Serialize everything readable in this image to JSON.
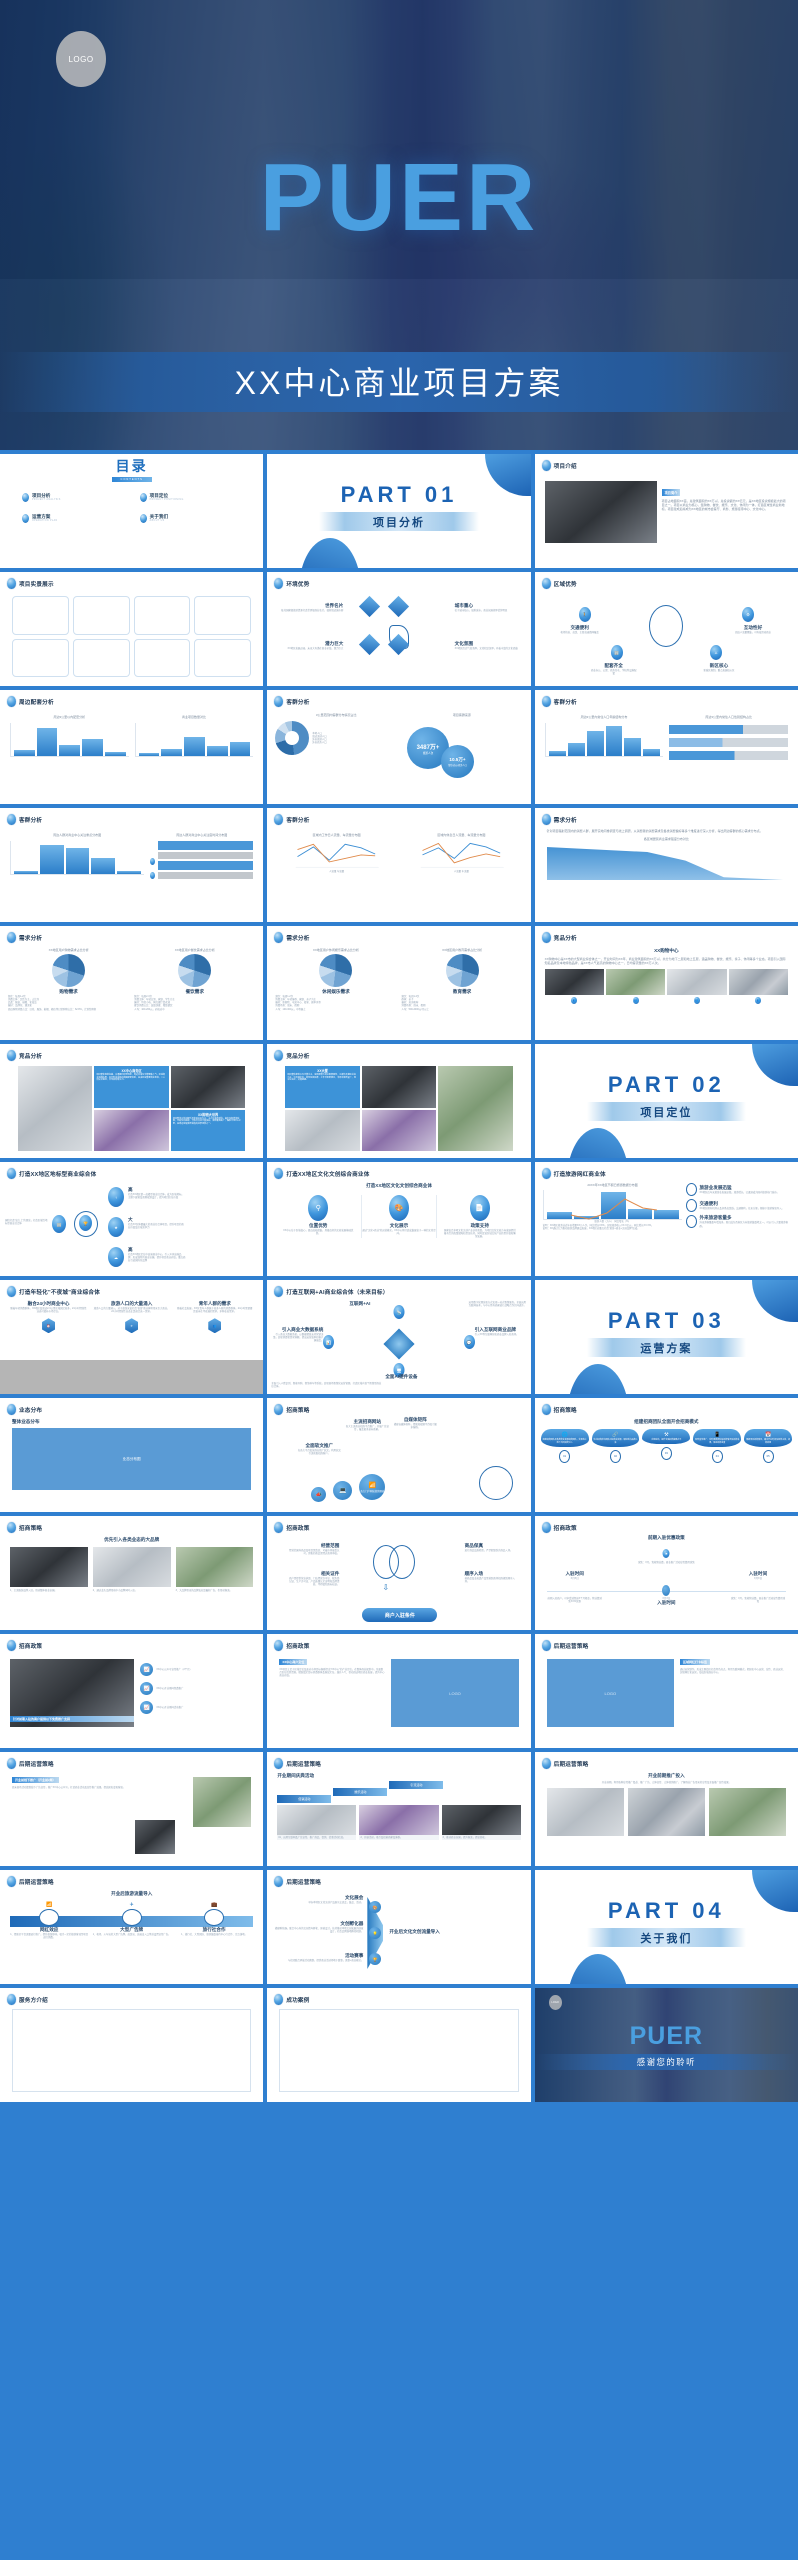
{
  "cover": {
    "logo": "LOGO",
    "title": "PUER",
    "subtitle": "XX中心商业项目方案"
  },
  "toc": {
    "heading": "目录",
    "heading_en": "CONTENTS",
    "items": [
      {
        "label": "项目分析",
        "sub": "PROJECT ANALYSIS"
      },
      {
        "label": "项目定位",
        "sub": "PROJECT POSITIONING"
      },
      {
        "label": "运营方案",
        "sub": "OPERATION PLAN"
      },
      {
        "label": "关于我们",
        "sub": "ABOUT US"
      }
    ]
  },
  "parts": [
    {
      "no": "PART  01",
      "name": "项目分析"
    },
    {
      "no": "PART  02",
      "name": "项目定位"
    },
    {
      "no": "PART  03",
      "name": "运营方案"
    },
    {
      "no": "PART  04",
      "name": "关于我们"
    }
  ],
  "thanks": {
    "logo": "LOGO",
    "title": "PUER",
    "subtitle": "感谢您的聆听"
  },
  "slides": {
    "s03": {
      "title": "项目介绍",
      "ribbon": "项目简介",
      "body": "项目占地面积XX亩，总建筑面积约XX万㎡，总投资额约XX亿元，是XX地区投资规模最大的项目之一。项目以商业为核心，集购物、餐饮、娱乐、文化、休闲为一体，打造区域性商业新地标。项目建成后将成为XX地区的城市会客厅、商务、旅游接待中心、文化中心。"
    },
    "s04": {
      "title": "项目实景展示"
    },
    "s05": {
      "title": "环境优势",
      "nodes": [
        {
          "label": "世界名片",
          "desc": "依托国家级旅游资源打造世界级商业名片，辐射周边城市群"
        },
        {
          "label": "城市重心",
          "desc": "位于城市核心，辐射城市，商业氛围浓厚优势明显"
        },
        {
          "label": "潜力巨大",
          "desc": "XX地区发展迅速，未来大有潜在商业价值，潜力巨大"
        },
        {
          "label": "文化氛围",
          "desc": "XX地区历史气息浓厚，文化积淀深厚，有着丰富的文化底蕴"
        }
      ]
    },
    "s06": {
      "title": "区域优势",
      "nodes": [
        {
          "label": "交通便利",
          "desc": "机场快轨、高铁、主要高速路网覆盖"
        },
        {
          "label": "互动性好",
          "desc": "周边人流量聚集，可有效带动商业"
        },
        {
          "label": "配套齐全",
          "desc": "商业办公、公寓、商务住宅、学校等设施配套"
        },
        {
          "label": "新区核心",
          "desc": "新城区规划，重点发展核心区"
        }
      ]
    },
    "s07": {
      "title": "周边配套分析",
      "chart_left_title": "周边3公里以内配套分析",
      "chart_right_title": "商业项目数量对比"
    },
    "s08": {
      "title": "客群分析",
      "donut_title": "3公里范围内客群分布情况占比",
      "legend": [
        "本地人口",
        "周边流动人口",
        "外来旅游人口",
        "外来商务人口"
      ],
      "bubble_title": "项目客群来源",
      "big_value": "3487万+",
      "big_label": "旅游人次",
      "small_value": "10.5万+",
      "small_label": "常住/办公/商务人口"
    },
    "s09": {
      "title": "客群分析",
      "chart_left_title": "周边3公里内常住人口年龄结构分布",
      "chart_right_title": "周边3公里内常住人口性别结构占比"
    },
    "s10": {
      "title": "客群分析",
      "chart_left_title": "周边人群对商业中心关注重点分布图",
      "chart_right_title": "周边人群对商业中心关注度时间分布图"
    },
    "s11": {
      "title": "客群分析",
      "chart_left_title": "区域内工作日人流量、车流量分布图",
      "chart_right_title": "区域内休息日人流量、车流量分布图",
      "legend": [
        "人流量",
        "车流量"
      ]
    },
    "s12": {
      "title": "需求分析",
      "intro": "针对项目辐射范围内的消费人群，展开实地问卷调查与线上调研，从消费者的消费需求及各类消费偏好等多个维度进行深入分析，得出周边客群的核心需求分布点。",
      "chart_title": "各区域居民商业需求强度分布对比"
    },
    "s13": {
      "title": "需求分析",
      "charts": [
        {
          "title": "XX地区用户购物需求占比分析",
          "label": "购物需求",
          "desc": "频次：每周1-2次\n消费主体：女性为主，占比约\n品类：服装、鞋帽、化妆品\n偏好：品牌化、潮流化\n周边购物消费占比：日化、服饰、鞋帽、箱包等日常购物占比：62.8%，计划性购物"
        },
        {
          "title": "XX地区用户餐饮需求占比分析",
          "label": "餐饮需求",
          "desc": "频次：每周2-3次\n消费主体：年轻白领、家庭、学生为主\n偏好：特色小吃、网红餐厅受欢迎\n餐饮消费占比：连锁快餐、精致餐饮\n人均：100-200元，价格适中"
        }
      ]
    },
    "s14": {
      "title": "需求分析",
      "charts": [
        {
          "title": "XX地区用户休闲娱乐需求占比分析",
          "label": "休闲娱乐需求",
          "desc": "频次：每周1-2次\n消费主体：年轻客群、家庭、亲子为主\n偏好：影剧院、电竞中心、密室、剧本杀等\n消费场景：周末、假期\n人均：100-300元，中等偏上"
        },
        {
          "title": "XX地区用户教育需求占比分析",
          "label": "教育需求",
          "desc": "频次：每周1-2次\n群体：亲子\n偏好：培训机构\n消费场景：周末、假期\n人均：500-2000元/月以上"
        }
      ]
    },
    "s15": {
      "title": "竞品分析",
      "sub": "XX购物中心",
      "body": "XX购物中心是XX市的大型商业综合体之一，开业时间为XX年，商业建筑面积约XX万㎡，共分为地下二层和地上五层，涵盖购物、餐饮、娱乐、亲子、休闲等多个业态。项目引入国际知名品牌及本地特色品牌，是XX市人气最高的购物中心之一，日均客流量约XX万人次。"
    },
    "s16": {
      "title": "竞品分析",
      "ribbon": "XX中心商务区",
      "ribbon2": "XX购物大世界",
      "body": "项目整体规划完善，交通便利优势明显，周边高端写字楼聚集人气，区域商业氛围浓厚，且已形成成熟的商圈配套体系，是该区域重要商业载体，二三层设计独特，非常具有吸引力。",
      "body2": "项目整体以休闲娱乐及体验业态为主，主力店涵盖影院、超市及各类体验馆，中庭空间宽敞，节假日活动丰富多彩，客群覆盖面广，辐射半径约5公里，是周边家庭客群首选的消费场所之一。"
    },
    "s17": {
      "title": "竞品分析",
      "ribbon": "XX大厦",
      "body": "项目整体建筑以写字楼为主，底部裙楼为商业配套服务，以餐饮及便民业态为主，中高端定位，商务氛围浓厚，工作日客群稳定，非周末客群量少，停车位充足，交通便捷。"
    },
    "s18": {
      "title": "打造XX地区地标型商业综合体",
      "center": "地标",
      "left_desc": "围绕打造\"高大上\"的理念，打造区域性地标型商业综合体",
      "nodes": [
        {
          "label": "高",
          "desc": "打造XX地区第一高楼型商业综合体，成为区域地标，主题下建筑及景观规划设计，提升项目区位价值"
        },
        {
          "label": "大",
          "desc": "打造XX区体量最大的商业综合体项目，提升项目的商业价值及区域竞争力"
        },
        {
          "label": "高",
          "desc": "打造XX地区定位中高端商业中心，引入众多高端品牌，形成独特的商业氛围，提升项目商业价值，重点商业引进国际化品牌"
        }
      ]
    },
    "s19": {
      "title": "打造XX地区文化文创综合商业体",
      "sub": "打造XX地区文化文创综合商业体",
      "cards": [
        {
          "label": "位置优势",
          "desc": "XX中心位于区域核心，周边高校密集，具备良好的文创发展基础优势。"
        },
        {
          "label": "文化展示",
          "desc": "通过\"文化+商业\"的运营模式，XX中心将打造成集展览于一体的文化空间。"
        },
        {
          "label": "政策支持",
          "desc": "国家出台多项文化文创产业扶持政策，为项目文化文创方向发展提供强有力的政策保障和资金扶持，同时促进区域文化产业转型升级和繁荣发展。"
        }
      ]
    },
    "s20": {
      "title": "打造旅游网红商业体",
      "chart_title": "20XX年XX地区节假日旅游数据分布图",
      "legend": [
        "旅游人数（万人）",
        "同比增长（%）"
      ],
      "nodes": [
        {
          "label": "旅游业发展迅猛",
          "desc": "XX地区近年来旅游业发展迅猛，旅游增长，已逐渐成为国内旅游热门城市。"
        },
        {
          "label": "交通便利",
          "desc": "XX地区拥有机场以及多条高铁线，交通便利，往来方便，便捷于旅游客流导入。"
        },
        {
          "label": "外来旅游客量多",
          "desc": "外来游客量逐年增加多，现已成为西南区方向旅游集散地之一，可以引入大量旅游客群。"
        }
      ],
      "footer": "说明：XX地区旅游业近年来增量XX万人次，同比增长XX%，实现旅游收入XX.X亿元，同比增长XX.X%。\n说明：XX通过大力推动旅游品牌建设发展，XX地区应重点打造\"旅游+商业+文创品牌\"形成。"
    },
    "s21": {
      "title": "打造年轻化\"不夜城\"商业综合体",
      "cards": [
        {
          "label": "融合24小时商业中心",
          "desc": "随着年轻消费群体，XX地区及周边2-3公里区域居民较多，24小时经营性业态可填补市场空白。"
        },
        {
          "label": "旅游人口的大量涌入",
          "desc": "旅游人口的大量涌入，对于旅游来说打造\"夜游\"商业体将带来巨大商业，24小时经营性业态正是迎合这一需求。"
        },
        {
          "label": "青年人群的需求",
          "desc": "随着社会发展，XX区青年人群属于较多人群的消费群体，24小时需要餐饮夜宵在不夜城的需求，多种业态需求。"
        }
      ]
    },
    "s22": {
      "title": "打造互联网+AI商业综合体（未来目标）",
      "nodes": [
        {
          "label": "互联网+AI",
          "desc": "运用数字化理念和方式实现一站式智慧服务，全面运用互联网技术，与中心所有商家进行战略合作共同进步。"
        },
        {
          "label": "引入商业大数据系统",
          "desc": "引入商业大数据系统，以数据精准支持营销决策，实现消费者需求洞察，提高运营效率和客户满意度。"
        },
        {
          "label": "引入互联网商业品牌",
          "desc": "引入XX等互联网知名商业品牌入驻商场。"
        },
        {
          "label": "全面AI硬件设备",
          "desc": "全面引入人脸识别、智能导购、智慧停车等系统，实现商场智慧化运营管理，打造区域内首个智慧型商业综合体。"
        }
      ]
    },
    "s23": {
      "title": "业态分布",
      "sub": "整体业态分布",
      "placeholder": "业态分布图"
    },
    "s24": {
      "title": "招商策略",
      "nodes": [
        {
          "label": "全面软文推广",
          "desc": "在各大平台投放商业推广软文，利用软文引流获取招商客户。"
        },
        {
          "label": "主流招商网站",
          "desc": "各大主流商业招商平台推广，开展广告宣传，覆盖更多意向商家。"
        },
        {
          "label": "自媒体矩阵",
          "desc": "搭建自媒体矩阵，借助短视频平台吸引更多客群。"
        },
        {
          "label": "各大门户网站营销预热",
          "desc": "在各大门户网站发布招商信息，提前进行品牌造势。"
        }
      ]
    },
    "s25": {
      "title": "招商策略",
      "sub": "组建招商团队全面开会招商模式",
      "steps": [
        {
          "no": "01",
          "desc": "组建招商团队及各类商业资源招商团队，实现线上线下共同招商引入"
        },
        {
          "no": "02",
          "desc": "外出招商拜访团队对应商业资源，取得重点品牌入驻"
        },
        {
          "no": "03",
          "desc": "定期总结，提升全面招商策略水平"
        },
        {
          "no": "04",
          "desc": "配合宣传推广、实时更新各阶段招商情况及招商成果，保证招商进度"
        },
        {
          "no": "05",
          "desc": "根据项目招商情况，确定开业时间及经营主体，招商收尾"
        }
      ]
    },
    "s26": {
      "title": "招商策略",
      "sub": "优先引入各类业态的大品牌",
      "captions": [
        "1、主流服饰品牌入驻，带动整体商业氛围。",
        "2、通过龙头品牌带动中小品牌同时入驻。",
        "3、大品牌带来的品牌效应是最好广告，也带动客流。"
      ]
    },
    "s27": {
      "title": "招商政策",
      "button": "商户入驻条件",
      "items": [
        {
          "label": "经营范围",
          "desc": "经营范围内商品及项目需真实、可被市场接受认可，销售的商品需经过商场审核。"
        },
        {
          "label": "商品保真",
          "desc": "进行商品品质检验，严禁假冒伪劣商品入场。"
        },
        {
          "label": "相关证件",
          "desc": "商户需提供营业执照、门店经营许可证、税务登记证、生产许可证、产品质量认定证明和品牌资质、不得侵犯商标权益。"
        },
        {
          "label": "顺序入场",
          "desc": "按商品及业态类产品需按照商场招商规划顺序入场。"
        }
      ]
    },
    "s28": {
      "title": "招商政策",
      "sub": "前期入驻优惠政策",
      "nodes": [
        {
          "label": "入驻时间",
          "date": "X月X日",
          "desc": "前期入驻商户，可享受减免前X个月租金，物业费减免XX%优惠"
        },
        {
          "label": "入驻时间",
          "date": "X月X日",
          "desc": "减免：X月，免收物业费，商业推广活动宣传费用减免"
        },
        {
          "label": "入驻时间",
          "date": "X月X日",
          "desc": "减免：X月，免收物业费，商业推广活动宣传费用减免"
        }
      ]
    },
    "s29": {
      "title": "招商政策",
      "ribbon": "针对前期入驻的商户提供以下免费推广支持",
      "items": [
        {
          "desc": "XX中心公众号宣传推广（2个月）"
        },
        {
          "desc": "XX中心开业期间免费推广"
        },
        {
          "desc": "XX中心开业期间活动推广"
        }
      ]
    },
    "s30": {
      "title": "招商政策",
      "ribbon": "XX中心商户定位",
      "body": "XX项目立足于区域定位及面对市场目标客群提出\"XX中心\"的产业定位，在整体商业规划中，全面整合区位优势资源，精准锁定目标消费群体及客层定位，兼并人气、带动周边地区商业发展，提升中心商业价值。",
      "placeholder": "LOGO"
    },
    "s31": {
      "title": "后期运营策略",
      "ribbon": "区域网红打卡标签",
      "body": "通过运营制作，形成主题街区打造特色亮点，利用互联网模式，把知名中心运营、宣传、商业运营、实现网红化运营，形成区域商业中心。",
      "placeholder": "LOGO"
    },
    "s32": {
      "title": "后期运营策略",
      "ribbon": "开业前线下推广（开业前2周）",
      "body": "周末商场活动策划线下广告宣传，推广XX中心公众号，打造商业活动及宣传推广效果，提高知名度和客流。"
    },
    "s33": {
      "title": "后期运营策略",
      "sub": "开业期间庆典活动",
      "tabs": [
        "促销活动",
        "娱乐活动",
        "引流活动"
      ],
      "captions": [
        "01、运用互联网及广告宣传，推广商品、促销、优惠活动信息。",
        "2、开展活动，吸引及招募商家及客群。",
        "3、推动商业氛围，提升客流，提高营收。"
      ]
    },
    "s34": {
      "title": "后期运营策略",
      "sub": "开业前期推广投入",
      "desc": "开业前期，利用各种宣传推广渠道、推广广告、立体宣传、立体营销推广，了解商业广告带来的宣传及全面推广宣传效果。"
    },
    "s35": {
      "title": "后期运营策略",
      "sub": "开业后旅游流量导入",
      "nodes": [
        {
          "label": "网红效应",
          "desc": "1、借助全平台流量进行推广，提升旅游影响，吸引一定的旅游客流至项目进行消费。"
        },
        {
          "label": "大型广告牌",
          "desc": "1、机场、火车站的大型广告牌，高铁站、高速出入口等处设置宣传广告。"
        },
        {
          "label": "旅行社合作",
          "desc": "1、旅行社、大型团队、旅游集散接待中心行合作、定点落地。"
        }
      ]
    },
    "s36": {
      "title": "后期运营策略",
      "result": "开业后文化文创流量导入",
      "nodes": [
        {
          "label": "文化展会",
          "desc": "举办本地区文化文创产品展示交流会，集品、活动。"
        },
        {
          "label": "文创孵化器",
          "desc": "搭建孵化器，联合中心内的文创青年孵化、原创设计，扶持推动本地文创发展的创意设计，打造品牌落地孵化机制。"
        },
        {
          "label": "活动赛事",
          "desc": "与社团联合承接活动赛事，提供商业活动场地于赛事，赛事+商业模式。"
        }
      ]
    },
    "s37": {
      "title": "服务方介绍"
    },
    "s38": {
      "title": "成功案例"
    }
  }
}
